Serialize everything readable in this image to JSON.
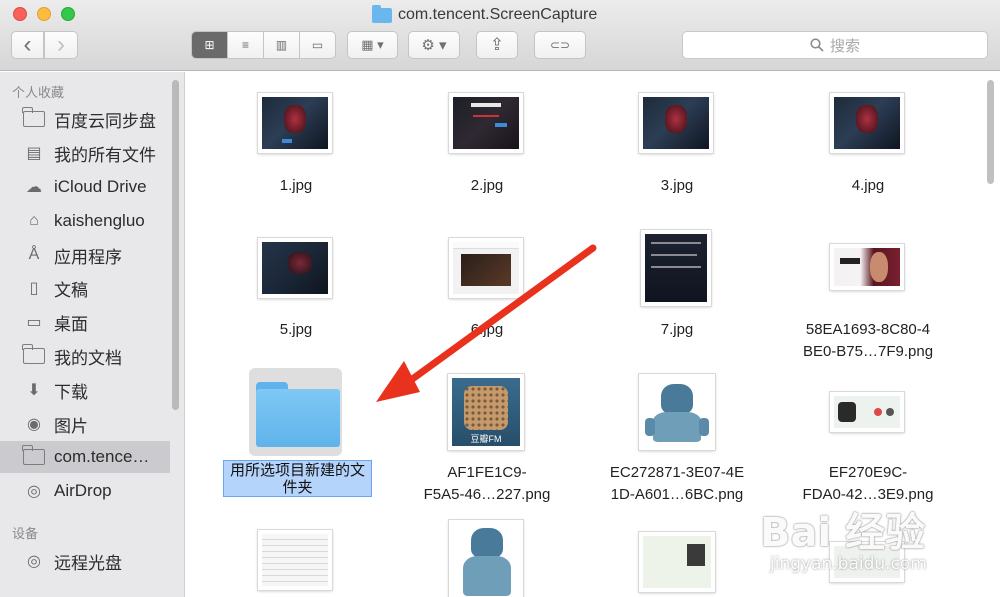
{
  "window": {
    "title": "com.tencent.ScreenCapture"
  },
  "toolbar": {
    "back": "‹",
    "forward": "›",
    "view_icons": [
      "⊞",
      "≡",
      "▥",
      "▭"
    ],
    "arrange": "▦ ▾",
    "action": "⚙ ▾",
    "share": "⇪",
    "tag": "⊂⊃",
    "search_placeholder": "搜索"
  },
  "sidebar": {
    "favorites_heading": "个人收藏",
    "favorites": [
      {
        "label": "百度云同步盘",
        "icon": "folder-icon"
      },
      {
        "label": "我的所有文件",
        "icon": "all-files-icon"
      },
      {
        "label": "iCloud Drive",
        "icon": "cloud-icon"
      },
      {
        "label": "kaishengluo",
        "icon": "home-icon"
      },
      {
        "label": "应用程序",
        "icon": "applications-icon"
      },
      {
        "label": "文稿",
        "icon": "documents-icon"
      },
      {
        "label": "桌面",
        "icon": "desktop-icon"
      },
      {
        "label": "我的文档",
        "icon": "folder-icon"
      },
      {
        "label": "下载",
        "icon": "download-icon"
      },
      {
        "label": "图片",
        "icon": "camera-icon"
      },
      {
        "label": "com.tence…",
        "icon": "folder-icon"
      },
      {
        "label": "AirDrop",
        "icon": "airdrop-icon"
      }
    ],
    "devices_heading": "设备",
    "devices": [
      {
        "label": "远程光盘",
        "icon": "disc-icon"
      }
    ]
  },
  "files": [
    {
      "name": "1.jpg"
    },
    {
      "name": "2.jpg"
    },
    {
      "name": "3.jpg"
    },
    {
      "name": "4.jpg"
    },
    {
      "name": "5.jpg"
    },
    {
      "name": "6.jpg"
    },
    {
      "name": "7.jpg"
    },
    {
      "name_line1": "58EA1693-8C80-4",
      "name_line2": "BE0-B75…7F9.png"
    },
    {
      "name_line1": "用所选项目新建的文",
      "name_line2": "件夹"
    },
    {
      "name_line1": "AF1FE1C9-",
      "name_line2": "F5A5-46…227.png",
      "badge": "豆瓣FM"
    },
    {
      "name_line1": "EC272871-3E07-4E",
      "name_line2": "1D-A601…6BC.png"
    },
    {
      "name_line1": "EF270E9C-",
      "name_line2": "FDA0-42…3E9.png"
    }
  ],
  "watermark": {
    "main": "Bai 经验",
    "sub": "jingyan.baidu.com"
  },
  "colors": {
    "folder": "#5fb3ea",
    "selection": "#b5d4fb",
    "annotation_arrow": "#e8321e"
  }
}
